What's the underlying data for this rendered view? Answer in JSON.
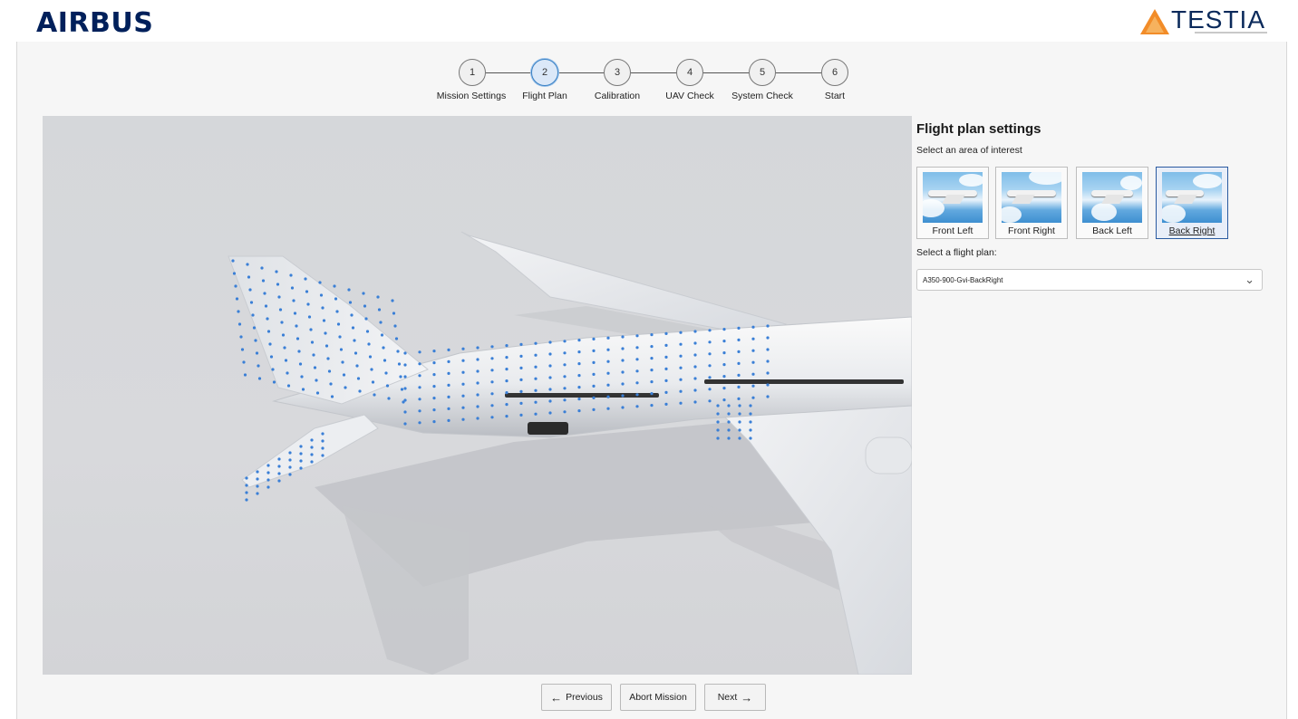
{
  "brand": {
    "left_logo": "AIRBUS",
    "right_logo": "TESTIA"
  },
  "stepper": {
    "steps": [
      {
        "number": "1",
        "label": "Mission Settings"
      },
      {
        "number": "2",
        "label": "Flight Plan"
      },
      {
        "number": "3",
        "label": "Calibration"
      },
      {
        "number": "4",
        "label": "UAV Check"
      },
      {
        "number": "5",
        "label": "System Check"
      },
      {
        "number": "6",
        "label": "Start"
      }
    ],
    "active_step": 2
  },
  "panel": {
    "title": "Flight plan settings",
    "area_label": "Select an area of interest",
    "areas": [
      {
        "label": "Front Left"
      },
      {
        "label": "Front Right"
      },
      {
        "label": "Back Left"
      },
      {
        "label": "Back Right"
      }
    ],
    "selected_area": "Back Right",
    "plan_label": "Select a flight plan:",
    "plan_value": "A350-900-Gvi-BackRight"
  },
  "footer": {
    "previous_label": "Previous",
    "abort_label": "Abort Mission",
    "next_label": "Next"
  },
  "colors": {
    "accent": "#3b82c4",
    "airbus_navy": "#00205b",
    "waypoint": "#3a7fd6",
    "testia_orange": "#f28c28"
  },
  "icons": {
    "previous": "arrow-left-icon",
    "next": "arrow-right-icon",
    "dropdown": "chevron-down-icon"
  }
}
